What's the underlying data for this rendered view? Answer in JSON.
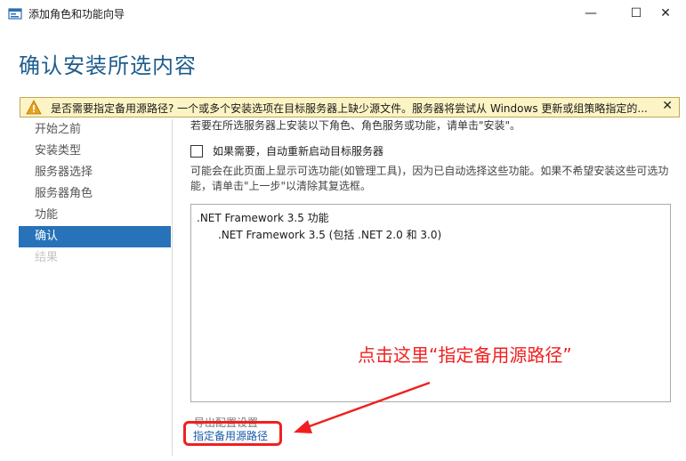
{
  "window": {
    "title": "添加角色和功能向导",
    "controls": {
      "minimize": "—",
      "maximize": "☐",
      "close": "✕"
    }
  },
  "heading": "确认安装所选内容",
  "warning": {
    "text": "是否需要指定备用源路径? 一个或多个安装选项在目标服务器上缺少源文件。服务器将尝试从 Windows 更新或组策略指定的...",
    "close": "✕"
  },
  "nav": {
    "items": [
      {
        "label": "开始之前",
        "state": "normal"
      },
      {
        "label": "安装类型",
        "state": "normal"
      },
      {
        "label": "服务器选择",
        "state": "normal"
      },
      {
        "label": "服务器角色",
        "state": "normal"
      },
      {
        "label": "功能",
        "state": "normal"
      },
      {
        "label": "确认",
        "state": "active"
      },
      {
        "label": "结果",
        "state": "disabled"
      }
    ]
  },
  "main": {
    "intro": "若要在所选服务器上安装以下角色、角色服务或功能，请单击\"安装\"。",
    "restart_checkbox": {
      "label": "如果需要，自动重新启动目标服务器",
      "checked": false
    },
    "info": "可能会在此页面上显示可选功能(如管理工具)，因为已自动选择这些功能。如果不希望安装这些可选功能，请单击\"上一步\"以清除其复选框。",
    "features": [
      {
        "label": ".NET Framework 3.5 功能",
        "level": 0
      },
      {
        "label": ".NET Framework 3.5 (包括 .NET 2.0 和 3.0)",
        "level": 1
      }
    ],
    "export_link": "导出配置设置",
    "alt_source_link": "指定备用源路径"
  },
  "annotation": {
    "text": "点击这里“指定备用源路径”",
    "color": "#f02020"
  },
  "colors": {
    "accent": "#2772b9",
    "heading": "#1e5d8c",
    "warning_bg": "#fcf4c4",
    "annotation": "#f02020"
  }
}
